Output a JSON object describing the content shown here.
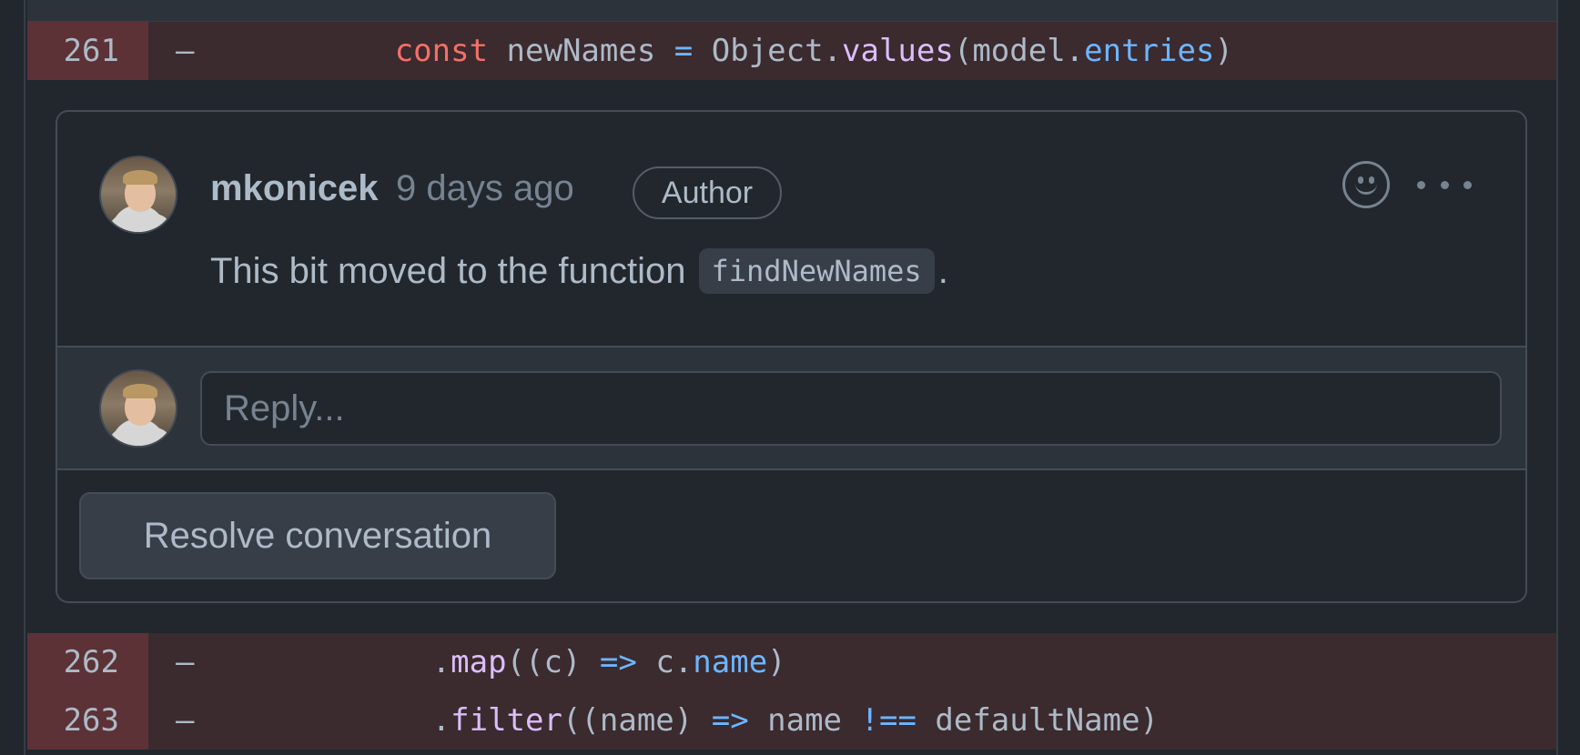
{
  "diff": {
    "line_261": {
      "number": "261",
      "sign": "–",
      "indent": "          ",
      "tokens": {
        "kw": "const",
        "t1": " newNames ",
        "op": "=",
        "t2": " Object.",
        "fn": "values",
        "t3": "(model.",
        "prop": "entries",
        "t4": ")"
      }
    },
    "line_262": {
      "number": "262",
      "sign": "–",
      "indent": "            ",
      "tokens": {
        "t1": ".",
        "fn": "map",
        "t2": "((c) ",
        "op": "=>",
        "t3": " c.",
        "prop": "name",
        "t4": ")"
      }
    },
    "line_263": {
      "number": "263",
      "sign": "–",
      "indent": "            ",
      "tokens": {
        "t1": ".",
        "fn": "filter",
        "t2": "((name) ",
        "op": "=>",
        "t3": " name ",
        "op2": "!==",
        "t4": " defaultName)"
      }
    }
  },
  "comment": {
    "author": "mkonicek",
    "timestamp": "9 days ago",
    "badge": "Author",
    "body_text": "This bit moved to the function",
    "body_code": "findNewNames",
    "body_end": "."
  },
  "reply": {
    "placeholder": "Reply..."
  },
  "actions": {
    "resolve_label": "Resolve conversation"
  },
  "icons": {
    "reaction": "smiley-icon",
    "menu": "kebab-menu-icon"
  },
  "colors": {
    "background": "#22272e",
    "deleted_line": "#3b2a2e",
    "deleted_gutter": "#5c3236",
    "keyword": "#f47067",
    "function": "#dcbdfb",
    "property": "#6cb6ff",
    "text": "#adbac7",
    "muted": "#768390"
  }
}
